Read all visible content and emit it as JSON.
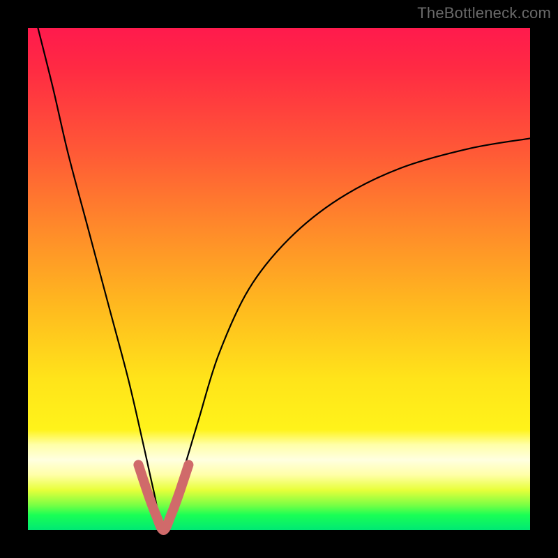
{
  "watermark": "TheBottleneck.com",
  "chart_data": {
    "type": "line",
    "title": "",
    "xlabel": "",
    "ylabel": "",
    "xlim": [
      0,
      100
    ],
    "ylim": [
      0,
      100
    ],
    "grid": false,
    "note": "Axes have no tick labels or numeric scale in the original image. Values below are estimated from pixel positions on a 0–100 normalized grid (x left→right, y bottom→top). The main black curve is a V-shaped bottleneck curve with its minimum near x≈27, y≈0. A short pink overlay traces only the bottom of the V.",
    "series": [
      {
        "name": "bottleneck-curve",
        "color": "#000000",
        "x": [
          2,
          5,
          8,
          12,
          16,
          20,
          23,
          25,
          27,
          29,
          31,
          34,
          38,
          44,
          52,
          62,
          74,
          88,
          100
        ],
        "y": [
          100,
          88,
          75,
          60,
          45,
          30,
          17,
          8,
          0,
          6,
          12,
          22,
          35,
          48,
          58,
          66,
          72,
          76,
          78
        ]
      },
      {
        "name": "min-region-highlight",
        "color": "#d06a6a",
        "x": [
          22,
          24,
          25.5,
          27,
          28.5,
          30,
          32
        ],
        "y": [
          13,
          7,
          3,
          0,
          3,
          7,
          13
        ]
      }
    ],
    "background_gradient_stops": [
      {
        "pos": 0.0,
        "color": "#ff1a4d"
      },
      {
        "pos": 0.4,
        "color": "#ff8a2a"
      },
      {
        "pos": 0.8,
        "color": "#fff31a"
      },
      {
        "pos": 0.86,
        "color": "#ffffe0"
      },
      {
        "pos": 1.0,
        "color": "#00e874"
      }
    ]
  }
}
